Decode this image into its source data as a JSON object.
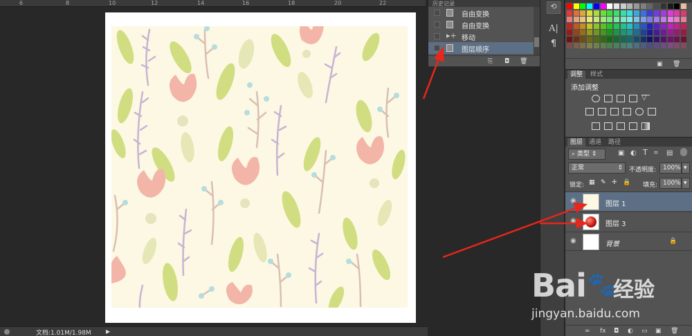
{
  "ruler": {
    "ticks": [
      "6",
      "8",
      "10",
      "12",
      "14",
      "16",
      "18",
      "20",
      "22"
    ]
  },
  "status": {
    "doc_info": "文档:1.01M/1.98M"
  },
  "history": {
    "tab_text": "历史记录",
    "items": [
      {
        "label": "自由变换",
        "selected": false
      },
      {
        "label": "自由变换",
        "selected": false
      },
      {
        "label": "移动",
        "selected": false
      },
      {
        "label": "图层顺序",
        "selected": true
      }
    ]
  },
  "adjustments": {
    "tabs": [
      "调整",
      "样式"
    ],
    "title": "添加调整"
  },
  "layers_panel": {
    "tabs": [
      "图层",
      "通道",
      "路径"
    ],
    "filter_kind": "类型",
    "blend_mode": "正常",
    "opacity_label": "不透明度:",
    "opacity": "100%",
    "lock_label": "锁定:",
    "fill_label": "填充:",
    "fill": "100%",
    "layers": [
      {
        "name": "图层 1",
        "selected": true,
        "thumb": "pattern"
      },
      {
        "name": "图层 3",
        "selected": false,
        "thumb": "red-ball"
      },
      {
        "name": "背景",
        "selected": false,
        "thumb": "white",
        "locked": true
      }
    ]
  },
  "watermark": {
    "brand": "Bai",
    "brand2": "经验",
    "url": "jingyan.baidu.com"
  },
  "colors": {
    "canvas_bg": "#fcf8e3",
    "panel_bg": "#535353",
    "selection": "#5c6f85",
    "arrow": "#e8261c"
  }
}
